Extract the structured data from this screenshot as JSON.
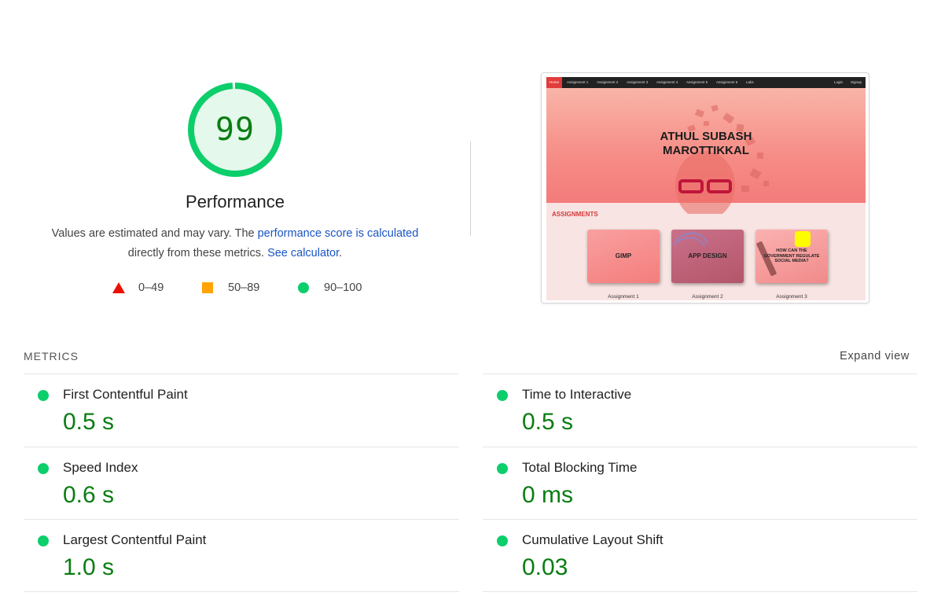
{
  "score": {
    "value": "99",
    "fraction": 0.99,
    "color": "#0cce6b"
  },
  "performance": {
    "title": "Performance",
    "desc_prefix": "Values are estimated and may vary. The ",
    "desc_link1": "performance score is calculated",
    "desc_mid": "directly from these metrics. ",
    "desc_link2": "See calculator",
    "desc_suffix": "."
  },
  "legend": [
    {
      "range": "0–49",
      "color": "#eb0f00",
      "icon": "triangle-icon"
    },
    {
      "range": "50–89",
      "color": "#ffa400",
      "icon": "square-icon"
    },
    {
      "range": "90–100",
      "color": "#0cce6b",
      "icon": "circle-icon"
    }
  ],
  "preview": {
    "nav": [
      "Home",
      "Assignment 1",
      "Assignment 2",
      "Assignment 3",
      "Assignment 4",
      "Assignment 5",
      "Assignment 6",
      "Labs",
      "Login",
      "Signup"
    ],
    "hero_line1": "ATHUL SUBASH",
    "hero_line2": "MAROTTIKKAL",
    "section": "ASSIGNMENTS",
    "cards": [
      {
        "title": "GIMP",
        "caption": "Assignment 1"
      },
      {
        "title": "APP DESIGN",
        "caption": "Assignment 2"
      },
      {
        "title": "HOW CAN THE GOVERNMENT REGULATE SOCIAL MEDIA?",
        "caption": "Assignment 3"
      }
    ]
  },
  "metrics": {
    "heading": "METRICS",
    "expand_label": "Expand view",
    "items": [
      {
        "label": "First Contentful Paint",
        "value": "0.5 s",
        "status": "good"
      },
      {
        "label": "Time to Interactive",
        "value": "0.5 s",
        "status": "good"
      },
      {
        "label": "Speed Index",
        "value": "0.6 s",
        "status": "good"
      },
      {
        "label": "Total Blocking Time",
        "value": "0 ms",
        "status": "good"
      },
      {
        "label": "Largest Contentful Paint",
        "value": "1.0 s",
        "status": "good"
      },
      {
        "label": "Cumulative Layout Shift",
        "value": "0.03",
        "status": "good"
      }
    ]
  }
}
